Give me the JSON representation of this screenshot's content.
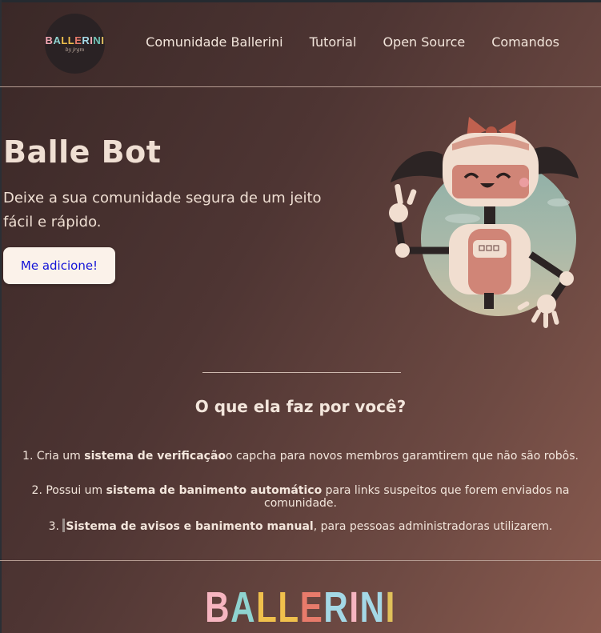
{
  "header": {
    "logo": {
      "letters": [
        "B",
        "A",
        "L",
        "L",
        "E",
        "R",
        "I",
        "N",
        "I"
      ],
      "colors": [
        "#f4a7b3",
        "#8fd3d0",
        "#f0c04c",
        "#f0c04c",
        "#e87b6b",
        "#a4d8e6",
        "#f4a7b3",
        "#6fc3b6",
        "#e7c463"
      ],
      "tagline": "by jrgm"
    },
    "nav": [
      "Comunidade Ballerini",
      "Tutorial",
      "Open Source",
      "Comandos"
    ]
  },
  "hero": {
    "title": "Balle Bot",
    "subtitle": "Deixe a sua comunidade segura de um jeito fácil e rápido.",
    "cta": "Me adicione!"
  },
  "features": {
    "title": "O que ela faz por você?",
    "items": [
      {
        "prefix": "1. Cria um ",
        "bold": "sistema de verificação",
        "suffix": "o capcha para novos membros garamtirem que não são robôs."
      },
      {
        "prefix": "2. Possui um ",
        "bold": "sistema de banimento automático",
        "suffix": " para links suspeitos que forem enviados na comunidade."
      },
      {
        "prefix": "3. ",
        "bold": "Sistema de avisos e banimento manual",
        "suffix": ", para pessoas administradoras utilizarem."
      }
    ]
  },
  "footer": {
    "letters": [
      "B",
      "A",
      "L",
      "L",
      "E",
      "R",
      "I",
      "N",
      "I"
    ],
    "colors": [
      "#f6b5c0",
      "#8fd3d0",
      "#f0c04c",
      "#f0c04c",
      "#e87b6b",
      "#a4d8e6",
      "#f6b5c0",
      "#a4d8e6",
      "#e0c15a"
    ]
  },
  "colors": {
    "cta_text": "#1414d8",
    "cta_bg": "#fbf2ea"
  }
}
